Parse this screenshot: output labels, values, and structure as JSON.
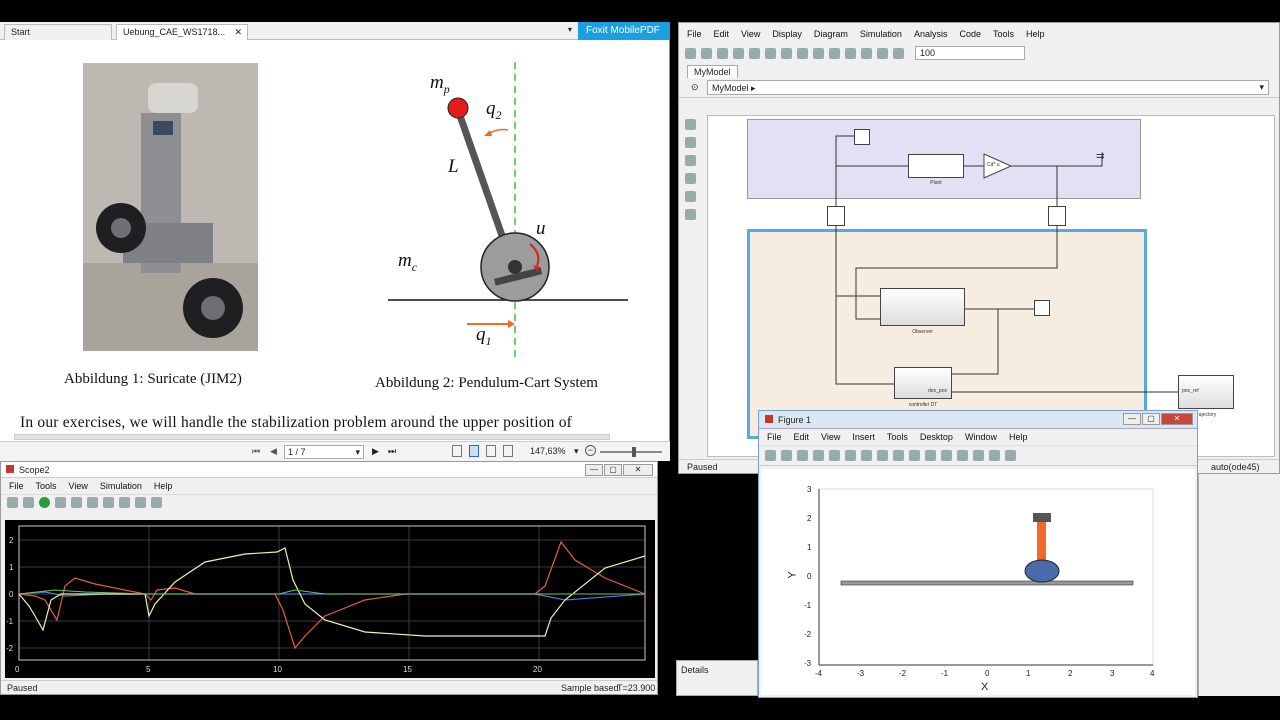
{
  "pdf": {
    "tabs": [
      "Start",
      "Uebung_CAE_WS1718..."
    ],
    "brand": "Foxit MobilePDF",
    "caption1": "Abbildung 1: Suricate (JIM2)",
    "caption2": "Abbildung 2: Pendulum-Cart System",
    "body_text": "In our exercises, we will handle the stabilization problem around the upper position of",
    "labels": {
      "mp": "m",
      "mp_sub": "p",
      "q2": "q",
      "q2_sub": "2",
      "L": "L",
      "u": "u",
      "mc": "m",
      "mc_sub": "c",
      "q1": "q",
      "q1_sub": "1"
    },
    "page_indicator": "1 / 7",
    "zoom": "147,63%"
  },
  "scope": {
    "title": "Scope2",
    "menu": [
      "File",
      "Tools",
      "View",
      "Simulation",
      "Help"
    ],
    "status_left": "Paused",
    "status_mid": "Sample based",
    "status_right": "T=23.900",
    "x_ticks": [
      "0",
      "5",
      "10",
      "15",
      "20"
    ],
    "y_ticks": [
      "2",
      "1",
      "0",
      "-1",
      "-2"
    ]
  },
  "simulink": {
    "menu": [
      "File",
      "Edit",
      "View",
      "Display",
      "Diagram",
      "Simulation",
      "Analysis",
      "Code",
      "Tools",
      "Help"
    ],
    "stop_time": "100",
    "tab": "MyModel",
    "breadcrumb": "MyModel",
    "blocks": {
      "plant": "Plant",
      "gain": "Cd* u",
      "observer": "Observer",
      "controller": "controller DT",
      "des_pos": "des_pos",
      "pos_ref": "pos_ref",
      "trajectory": "trajectory"
    },
    "status_left": "Paused",
    "status_right": "auto(ode45)",
    "details": "Details"
  },
  "figure": {
    "title": "Figure 1",
    "menu": [
      "File",
      "Edit",
      "View",
      "Insert",
      "Tools",
      "Desktop",
      "Window",
      "Help"
    ],
    "x_ticks": [
      "-4",
      "-3",
      "-2",
      "-1",
      "0",
      "1",
      "2",
      "3",
      "4"
    ],
    "y_ticks": [
      "3",
      "2",
      "1",
      "0",
      "-1",
      "-2",
      "-3"
    ],
    "xlabel": "X",
    "ylabel": "Y"
  },
  "colors": {
    "foxit": "#1aa0e0",
    "simulink_plant_bg": "#e2e0f4",
    "simulink_ctrl_bg": "#f7ece0",
    "scope_bg": "#000000",
    "pendulum": "#f26a2a",
    "wheel": "#4a6aa8"
  }
}
